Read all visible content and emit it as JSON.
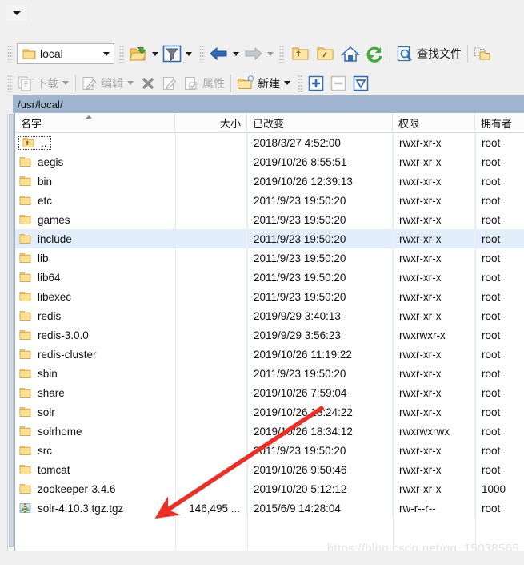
{
  "window": {
    "menu_chevron_icon": "chevron-down-icon"
  },
  "toolbar": {
    "path_combo": {
      "value": "local",
      "icon": "folder-icon",
      "caret_icon": "chevron-down-icon"
    },
    "buttons": [
      {
        "name": "open-directory",
        "icon": "open-folder-green-arrow-icon",
        "label": "",
        "has_caret": true,
        "disabled": false
      },
      {
        "name": "filter",
        "icon": "funnel-filter-icon",
        "label": "",
        "has_caret": true,
        "disabled": false
      },
      {
        "name": "back",
        "icon": "arrow-left-blue-icon",
        "label": "",
        "has_caret": true,
        "disabled": false
      },
      {
        "name": "forward",
        "icon": "arrow-right-gray-icon",
        "label": "",
        "has_caret": true,
        "disabled": true
      },
      {
        "name": "parent-directory",
        "icon": "folder-up-icon",
        "label": "",
        "has_caret": false,
        "disabled": false
      },
      {
        "name": "root-directory",
        "icon": "folder-slash-icon",
        "label": "",
        "has_caret": false,
        "disabled": false
      },
      {
        "name": "home-directory",
        "icon": "home-icon",
        "label": "",
        "has_caret": false,
        "disabled": false
      },
      {
        "name": "refresh",
        "icon": "refresh-green-icon",
        "label": "",
        "has_caret": false,
        "disabled": false
      },
      {
        "name": "find-files",
        "icon": "magnifier-document-icon",
        "label": "查找文件",
        "has_caret": false,
        "disabled": false
      },
      {
        "name": "folder-sync",
        "icon": "folder-compare-icon",
        "label": "",
        "has_caret": false,
        "disabled": false
      }
    ],
    "buttons2": [
      {
        "name": "download",
        "icon": "download-copy-icon",
        "label": "下载",
        "has_caret": true,
        "disabled": true
      },
      {
        "name": "edit",
        "icon": "edit-pencil-icon",
        "label": "编辑",
        "has_caret": true,
        "disabled": true
      },
      {
        "name": "delete",
        "icon": "x-delete-icon",
        "label": "",
        "has_caret": false,
        "disabled": true
      },
      {
        "name": "rename",
        "icon": "rename-icon",
        "label": "",
        "has_caret": false,
        "disabled": true
      },
      {
        "name": "properties",
        "icon": "properties-icon",
        "label": "属性",
        "has_caret": false,
        "disabled": true
      },
      {
        "name": "new",
        "icon": "new-folder-icon",
        "label": "新建",
        "has_caret": true,
        "disabled": false
      },
      {
        "name": "add",
        "icon": "plus-box-icon",
        "label": "",
        "has_caret": false,
        "disabled": false
      },
      {
        "name": "remove",
        "icon": "minus-box-icon",
        "label": "",
        "has_caret": false,
        "disabled": true
      },
      {
        "name": "select-filter",
        "icon": "triangle-down-box-icon",
        "label": "",
        "has_caret": false,
        "disabled": false
      }
    ]
  },
  "path_bar": {
    "path": "/usr/local/"
  },
  "file_list": {
    "columns": [
      {
        "key": "name",
        "label": "名字",
        "align": "left"
      },
      {
        "key": "size",
        "label": "大小",
        "align": "right"
      },
      {
        "key": "date",
        "label": "已改变",
        "align": "left"
      },
      {
        "key": "perm",
        "label": "权限",
        "align": "left"
      },
      {
        "key": "owner",
        "label": "拥有者",
        "align": "left"
      }
    ],
    "sort": {
      "column": "name",
      "direction": "ascending",
      "icon": "caret-up-icon"
    },
    "rows": [
      {
        "name": "..",
        "icon": "folder-up-icon",
        "size": "",
        "date": "2018/3/27 4:52:00",
        "perm": "rwxr-xr-x",
        "owner": "root",
        "selected": false,
        "focused": true,
        "type": "parent"
      },
      {
        "name": "aegis",
        "icon": "folder-icon",
        "size": "",
        "date": "2019/10/26 8:55:51",
        "perm": "rwxr-xr-x",
        "owner": "root",
        "selected": false,
        "focused": false,
        "type": "dir"
      },
      {
        "name": "bin",
        "icon": "folder-icon",
        "size": "",
        "date": "2019/10/26 12:39:13",
        "perm": "rwxr-xr-x",
        "owner": "root",
        "selected": false,
        "focused": false,
        "type": "dir"
      },
      {
        "name": "etc",
        "icon": "folder-icon",
        "size": "",
        "date": "2011/9/23 19:50:20",
        "perm": "rwxr-xr-x",
        "owner": "root",
        "selected": false,
        "focused": false,
        "type": "dir"
      },
      {
        "name": "games",
        "icon": "folder-icon",
        "size": "",
        "date": "2011/9/23 19:50:20",
        "perm": "rwxr-xr-x",
        "owner": "root",
        "selected": false,
        "focused": false,
        "type": "dir"
      },
      {
        "name": "include",
        "icon": "folder-icon",
        "size": "",
        "date": "2011/9/23 19:50:20",
        "perm": "rwxr-xr-x",
        "owner": "root",
        "selected": true,
        "focused": false,
        "type": "dir"
      },
      {
        "name": "lib",
        "icon": "folder-icon",
        "size": "",
        "date": "2011/9/23 19:50:20",
        "perm": "rwxr-xr-x",
        "owner": "root",
        "selected": false,
        "focused": false,
        "type": "dir"
      },
      {
        "name": "lib64",
        "icon": "folder-icon",
        "size": "",
        "date": "2011/9/23 19:50:20",
        "perm": "rwxr-xr-x",
        "owner": "root",
        "selected": false,
        "focused": false,
        "type": "dir"
      },
      {
        "name": "libexec",
        "icon": "folder-icon",
        "size": "",
        "date": "2011/9/23 19:50:20",
        "perm": "rwxr-xr-x",
        "owner": "root",
        "selected": false,
        "focused": false,
        "type": "dir"
      },
      {
        "name": "redis",
        "icon": "folder-icon",
        "size": "",
        "date": "2019/9/29 3:40:13",
        "perm": "rwxr-xr-x",
        "owner": "root",
        "selected": false,
        "focused": false,
        "type": "dir"
      },
      {
        "name": "redis-3.0.0",
        "icon": "folder-icon",
        "size": "",
        "date": "2019/9/29 3:56:23",
        "perm": "rwxrwxr-x",
        "owner": "root",
        "selected": false,
        "focused": false,
        "type": "dir"
      },
      {
        "name": "redis-cluster",
        "icon": "folder-icon",
        "size": "",
        "date": "2019/10/26 11:19:22",
        "perm": "rwxr-xr-x",
        "owner": "root",
        "selected": false,
        "focused": false,
        "type": "dir"
      },
      {
        "name": "sbin",
        "icon": "folder-icon",
        "size": "",
        "date": "2011/9/23 19:50:20",
        "perm": "rwxr-xr-x",
        "owner": "root",
        "selected": false,
        "focused": false,
        "type": "dir"
      },
      {
        "name": "share",
        "icon": "folder-icon",
        "size": "",
        "date": "2019/10/26 7:59:04",
        "perm": "rwxr-xr-x",
        "owner": "root",
        "selected": false,
        "focused": false,
        "type": "dir"
      },
      {
        "name": "solr",
        "icon": "folder-icon",
        "size": "",
        "date": "2019/10/26 18:24:22",
        "perm": "rwxr-xr-x",
        "owner": "root",
        "selected": false,
        "focused": false,
        "type": "dir"
      },
      {
        "name": "solrhome",
        "icon": "folder-icon",
        "size": "",
        "date": "2019/10/26 18:34:12",
        "perm": "rwxrwxrwx",
        "owner": "root",
        "selected": false,
        "focused": false,
        "type": "dir"
      },
      {
        "name": "src",
        "icon": "folder-icon",
        "size": "",
        "date": "2011/9/23 19:50:20",
        "perm": "rwxr-xr-x",
        "owner": "root",
        "selected": false,
        "focused": false,
        "type": "dir"
      },
      {
        "name": "tomcat",
        "icon": "folder-icon",
        "size": "",
        "date": "2019/10/26 9:50:46",
        "perm": "rwxr-xr-x",
        "owner": "root",
        "selected": false,
        "focused": false,
        "type": "dir"
      },
      {
        "name": "zookeeper-3.4.6",
        "icon": "folder-icon",
        "size": "",
        "date": "2019/10/20 5:12:12",
        "perm": "rwxr-xr-x",
        "owner": "1000",
        "selected": false,
        "focused": false,
        "type": "dir"
      },
      {
        "name": "solr-4.10.3.tgz.tgz",
        "icon": "archive-file-icon",
        "size": "146,495 ...",
        "date": "2015/6/9 14:28:04",
        "perm": "rw-r--r--",
        "owner": "root",
        "selected": false,
        "focused": false,
        "type": "file"
      }
    ]
  },
  "annotation": {
    "arrow_color": "#ee2d24",
    "target_row": "solr-4.10.3.tgz.tgz"
  },
  "watermark": {
    "text": "https://blog.csdn.net/qq_15038565"
  },
  "colors": {
    "selection": "#e3eefb",
    "path_bar_bg": "#a0b6d0",
    "chrome": "#f0f0f0",
    "folder": "#fcd87f",
    "accent_blue": "#2e6bbd"
  }
}
